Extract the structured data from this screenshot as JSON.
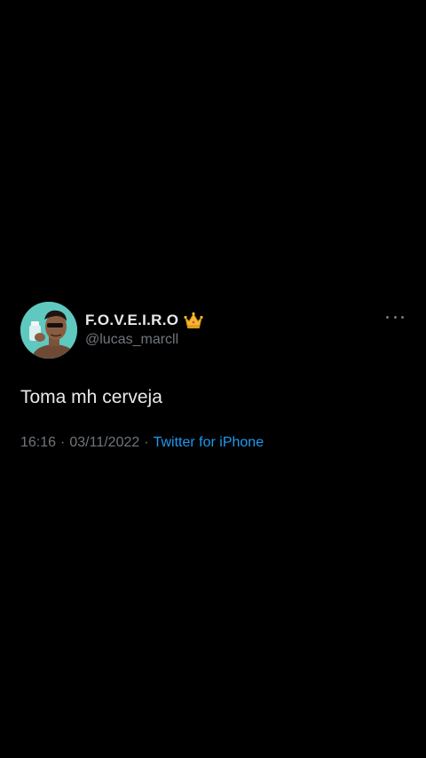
{
  "tweet": {
    "display_name": "F.O.V.E.I.R.O",
    "username": "@lucas_marcll",
    "text": "Toma mh cerveja",
    "time": "16:16",
    "date": "03/11/2022",
    "separator": "·",
    "source": "Twitter for iPhone",
    "name_emoji_icon": "crown-icon",
    "menu_icon": "more-icon"
  },
  "colors": {
    "background": "#000000",
    "primary_text": "#e7e9ea",
    "secondary_text": "#71767b",
    "link": "#1d9bf0",
    "avatar_background": "#5fc9c0"
  }
}
